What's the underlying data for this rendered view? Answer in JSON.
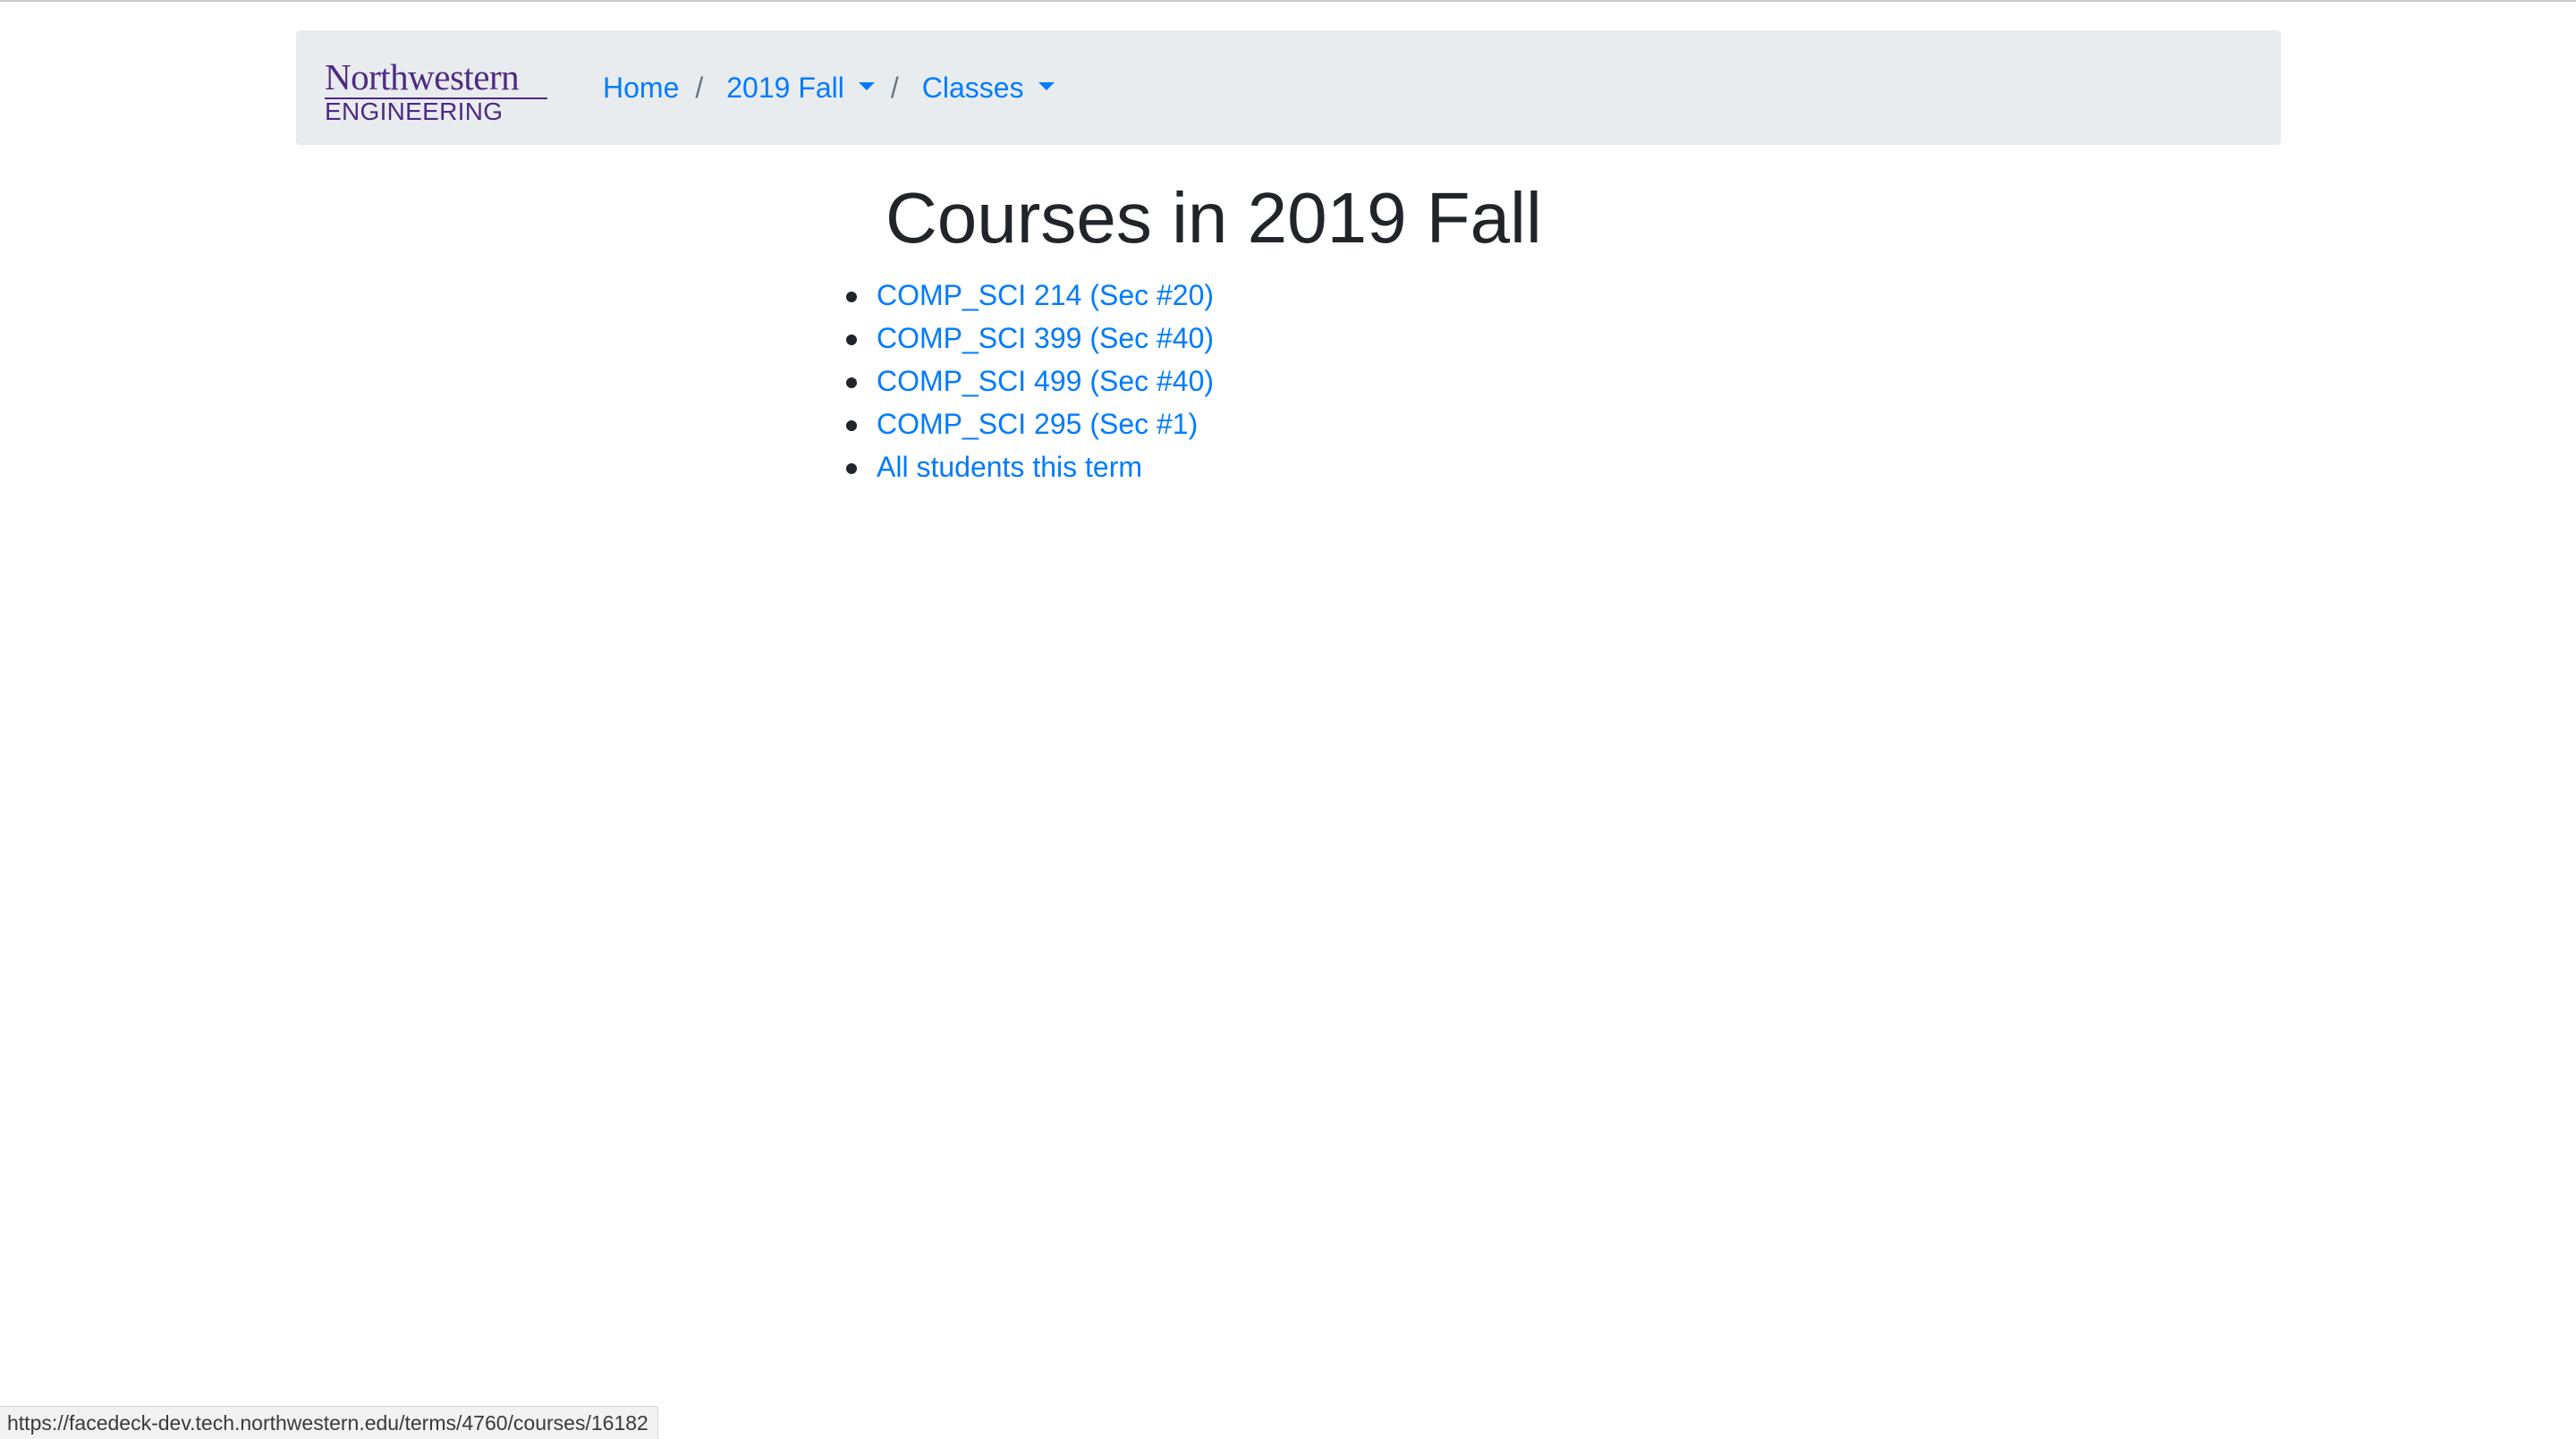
{
  "navbar": {
    "logo": {
      "line1": "Northwestern",
      "line2": "ENGINEERING"
    },
    "breadcrumb": {
      "home": "Home",
      "separator": "/",
      "term": "2019 Fall",
      "section": "Classes"
    }
  },
  "main": {
    "title": "Courses in 2019 Fall",
    "courses": [
      {
        "label": "COMP_SCI 214 (Sec #20)"
      },
      {
        "label": "COMP_SCI 399 (Sec #40)"
      },
      {
        "label": "COMP_SCI 499 (Sec #40)"
      },
      {
        "label": "COMP_SCI 295 (Sec #1)"
      },
      {
        "label": "All students this term"
      }
    ]
  },
  "status_bar": {
    "url": "https://facedeck-dev.tech.northwestern.edu/terms/4760/courses/16182"
  },
  "colors": {
    "link": "#007bff",
    "navbar_bg": "#e9ecef",
    "brand": "#4e2a84",
    "text": "#212529"
  }
}
